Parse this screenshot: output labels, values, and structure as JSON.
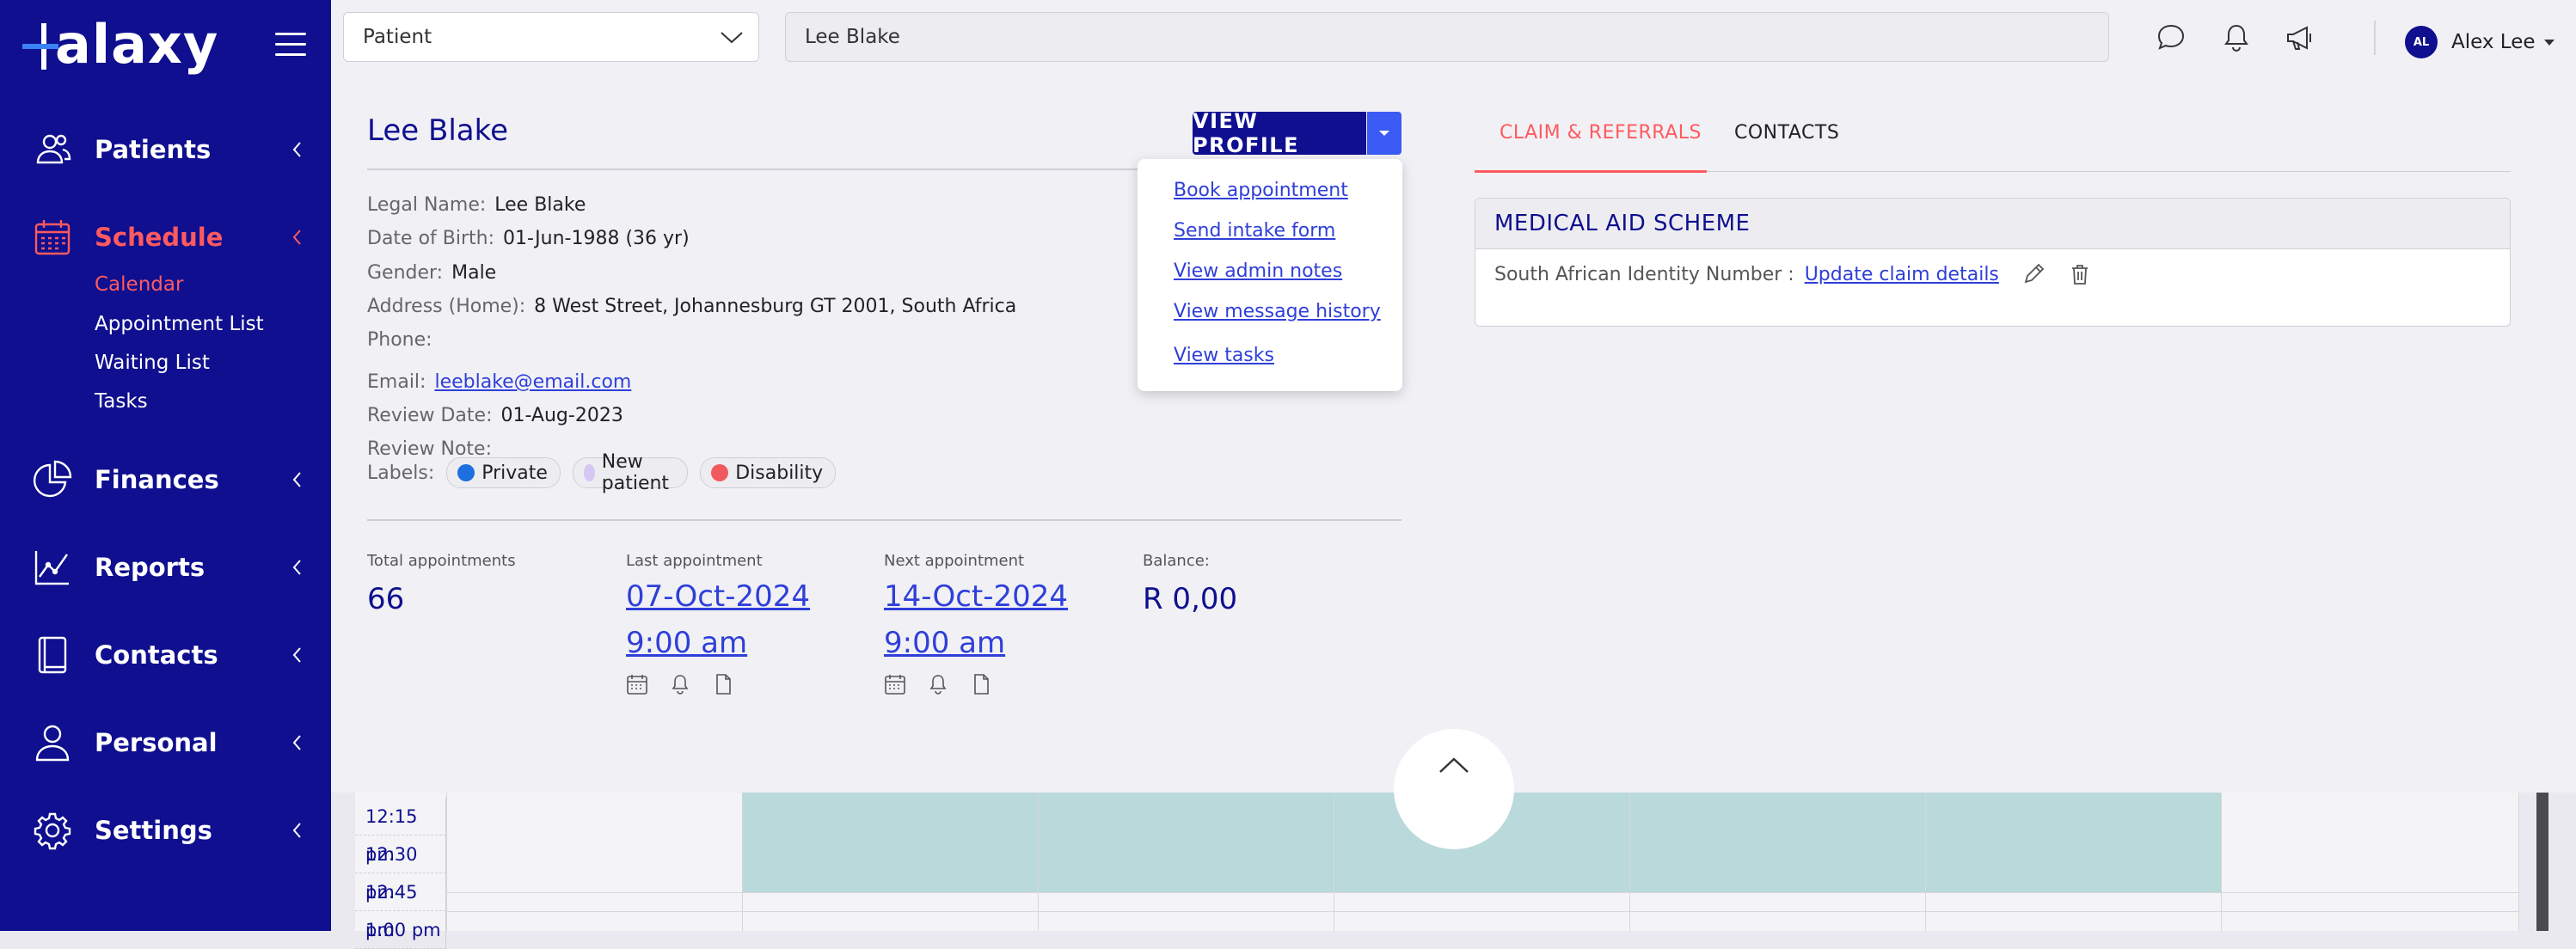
{
  "app": {
    "logo_text": "alaxy",
    "brand_colors": {
      "sidebar": "#0f0f8f",
      "accent": "#ff5a5f",
      "link": "#2f3fd8"
    }
  },
  "sidebar": {
    "items": [
      {
        "label": "Patients",
        "icon": "users-icon"
      },
      {
        "label": "Schedule",
        "icon": "calendar-icon",
        "active": true,
        "sub": [
          {
            "label": "Calendar",
            "active": true
          },
          {
            "label": "Appointment List"
          },
          {
            "label": "Waiting List"
          },
          {
            "label": "Tasks"
          }
        ]
      },
      {
        "label": "Finances",
        "icon": "pie-chart-icon"
      },
      {
        "label": "Reports",
        "icon": "line-chart-icon"
      },
      {
        "label": "Contacts",
        "icon": "address-book-icon"
      },
      {
        "label": "Personal",
        "icon": "person-icon"
      },
      {
        "label": "Settings",
        "icon": "gear-icon"
      }
    ]
  },
  "topbar": {
    "patient_select": "Patient",
    "search_value": "Lee Blake",
    "user_initials": "AL",
    "user_name": "Alex Lee"
  },
  "patient": {
    "name": "Lee Blake",
    "view_profile_label": "VIEW PROFILE",
    "fields": {
      "legal_name_label": "Legal Name:",
      "legal_name": "Lee Blake",
      "dob_label": "Date of Birth:",
      "dob": "01-Jun-1988 (36 yr)",
      "gender_label": "Gender:",
      "gender": "Male",
      "address_label": "Address (Home):",
      "address": "8 West Street, Johannesburg GT 2001, South Africa",
      "phone_label": "Phone:",
      "phone": "",
      "email_label": "Email:",
      "email": "leeblake@email.com",
      "review_date_label": "Review Date:",
      "review_date": "01-Aug-2023",
      "review_note_label": "Review Note:",
      "review_note": "",
      "labels_label": "Labels:"
    },
    "labels": [
      {
        "text": "Private",
        "color": "#1e6fe0"
      },
      {
        "text": "New patient",
        "color": "#d6c8f2"
      },
      {
        "text": "Disability",
        "color": "#f05a5f"
      }
    ],
    "stats": {
      "total_label": "Total appointments",
      "total_value": "66",
      "last_label": "Last appointment",
      "last_date": "07-Oct-2024",
      "last_time": "9:00 am",
      "next_label": "Next appointment",
      "next_date": "14-Oct-2024",
      "next_time": "9:00 am",
      "balance_label": "Balance:",
      "balance_value": "R 0,00"
    }
  },
  "dropdown": {
    "items": [
      "Book appointment",
      "Send intake form",
      "View admin notes",
      "View message history",
      "View tasks"
    ]
  },
  "tabs": {
    "claims": "CLAIM & REFERRALS",
    "contacts": "CONTACTS"
  },
  "claim": {
    "heading": "MEDICAL AID SCHEME",
    "id_label": "South African Identity Number :",
    "update_link": "Update claim details"
  },
  "calendar": {
    "times": [
      "12:15 pm",
      "12:30 pm",
      "12:45 pm",
      "1:00 pm"
    ]
  }
}
